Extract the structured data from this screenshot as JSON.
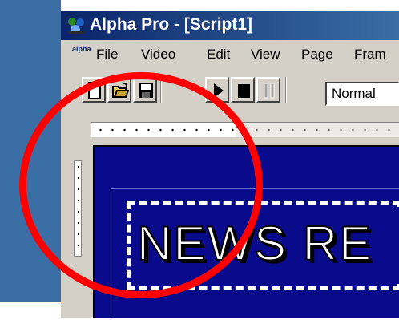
{
  "window": {
    "title": "Alpha Pro - [Script1]"
  },
  "menu": {
    "logo_text": "alpha",
    "items": [
      {
        "label": "File"
      },
      {
        "label": "Video"
      },
      {
        "label": "Edit"
      },
      {
        "label": "View"
      },
      {
        "label": "Page"
      },
      {
        "label": "Fram"
      }
    ]
  },
  "toolbar": {
    "buttons": [
      {
        "icon": "new-document-icon"
      },
      {
        "icon": "open-folder-icon"
      },
      {
        "icon": "save-disk-icon"
      },
      {
        "icon": "play-icon"
      },
      {
        "icon": "stop-icon"
      },
      {
        "icon": "pause-icon",
        "disabled": true
      }
    ],
    "style_select": {
      "value": "Normal"
    }
  },
  "canvas": {
    "headline": "NEWS RE"
  },
  "colors": {
    "titlebar": "#0a246a",
    "canvas_bg": "#0a0a8c",
    "annotation": "#ff0000",
    "desktop": "#3a6ea5"
  }
}
